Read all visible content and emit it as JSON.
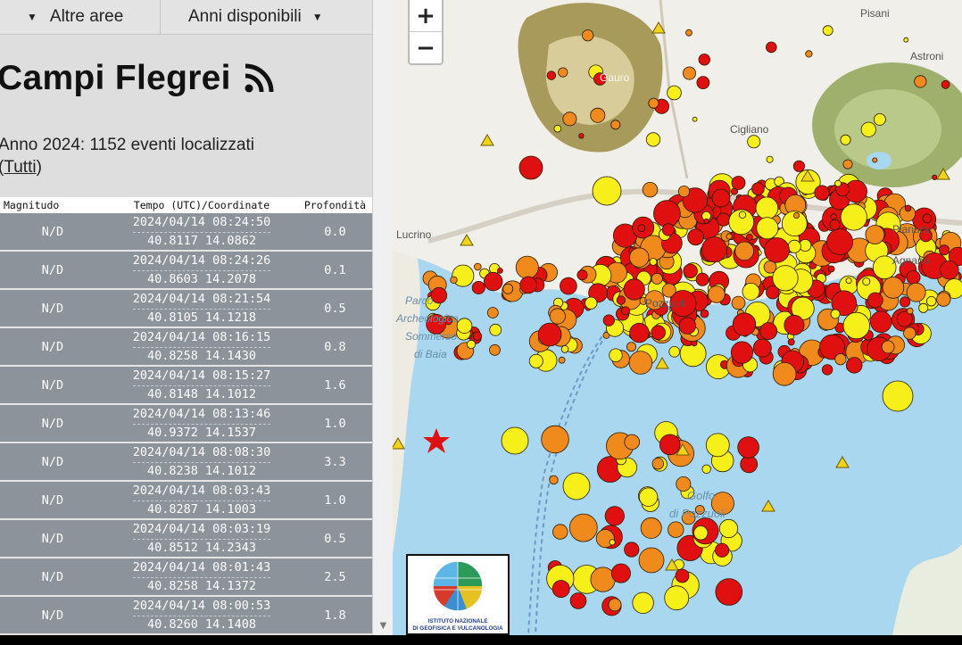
{
  "nav": {
    "altre_aree": "Altre aree",
    "anni_disponibili": "Anni disponibili"
  },
  "header": {
    "title": "Campi Flegrei",
    "summary": "Anno 2024: 1152 eventi localizzati",
    "filter_link": "Tutti"
  },
  "table": {
    "columns": [
      "Magnitudo",
      "Tempo (UTC)/Coordinate",
      "Profondità"
    ],
    "rows": [
      {
        "mag": "N/D",
        "time": "2024/04/14 08:24:50",
        "coords": "40.8117 14.0862",
        "depth": "0.0"
      },
      {
        "mag": "N/D",
        "time": "2024/04/14 08:24:26",
        "coords": "40.8603 14.2078",
        "depth": "0.1"
      },
      {
        "mag": "N/D",
        "time": "2024/04/14 08:21:54",
        "coords": "40.8105 14.1218",
        "depth": "0.5"
      },
      {
        "mag": "N/D",
        "time": "2024/04/14 08:16:15",
        "coords": "40.8258 14.1430",
        "depth": "0.8"
      },
      {
        "mag": "N/D",
        "time": "2024/04/14 08:15:27",
        "coords": "40.8148 14.1012",
        "depth": "1.6"
      },
      {
        "mag": "N/D",
        "time": "2024/04/14 08:13:46",
        "coords": "40.9372 14.1537",
        "depth": "1.0"
      },
      {
        "mag": "N/D",
        "time": "2024/04/14 08:08:30",
        "coords": "40.8238 14.1012",
        "depth": "3.3"
      },
      {
        "mag": "N/D",
        "time": "2024/04/14 08:03:43",
        "coords": "40.8287 14.1003",
        "depth": "1.0"
      },
      {
        "mag": "N/D",
        "time": "2024/04/14 08:03:19",
        "coords": "40.8512 14.2343",
        "depth": "0.5"
      },
      {
        "mag": "N/D",
        "time": "2024/04/14 08:01:43",
        "coords": "40.8258 14.1372",
        "depth": "2.5"
      },
      {
        "mag": "N/D",
        "time": "2024/04/14 08:00:53",
        "coords": "40.8260 14.1408",
        "depth": "1.8"
      }
    ]
  },
  "map": {
    "zoom_in": "+",
    "zoom_out": "−",
    "labels": {
      "pisani": "Pisani",
      "astroni": "Astroni",
      "gauro": "Gauro",
      "cigliano": "Cigliano",
      "lucrino": "Lucrino",
      "pozzuoli_town": "Pozzuoli",
      "agnano": "Agnano",
      "pianura": "Pianura",
      "parco_line1": "Parco",
      "parco_line2": "Archeologico",
      "parco_line3": "Sommerso",
      "parco_line4": "di Baia",
      "golfo_line1": "Golfo",
      "golfo_line2": "di Pozzuoli"
    },
    "logo_text_line1": "ISTITUTO NAZIONALE",
    "logo_text_line2": "DI GEOFISICA E VULCANOLOGIA",
    "colors": {
      "sea": "#a9d7f0",
      "land": "#f1efe9",
      "event_red": "#e01010",
      "event_orange": "#f08a1c",
      "event_yellow": "#f7ef1a",
      "station": "#f3d21a"
    }
  }
}
